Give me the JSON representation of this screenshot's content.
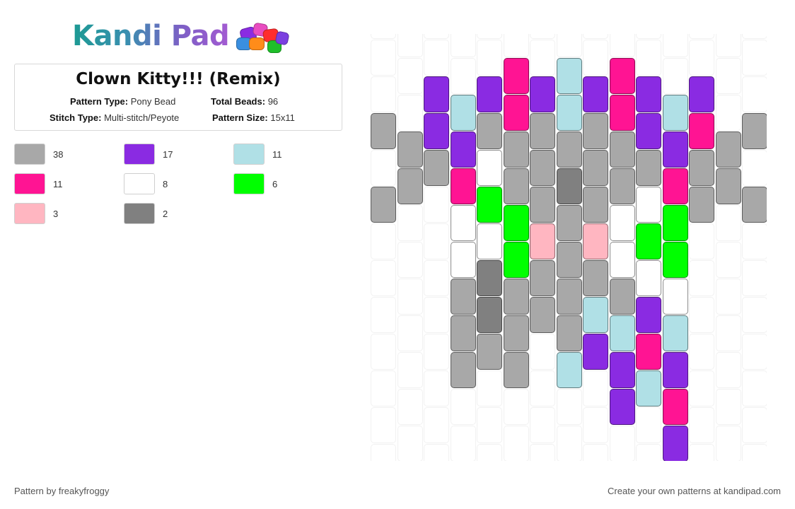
{
  "brand": {
    "name": "Kandi Pad"
  },
  "pattern": {
    "title": "Clown Kitty!!! (Remix)",
    "type_label": "Pattern Type:",
    "type_value": "Pony Bead",
    "total_label": "Total Beads:",
    "total_value": "96",
    "stitch_label": "Stitch Type:",
    "stitch_value": "Multi-stitch/Peyote",
    "size_label": "Pattern Size:",
    "size_value": "15x11"
  },
  "colors": {
    "gray": "#a8a8a8",
    "pink": "#ff1493",
    "lightpink": "#ffb6c1",
    "purple": "#8a2be2",
    "white": "#ffffff",
    "darkgray": "#808080",
    "lightblue": "#b0e0e6",
    "green": "#00ff00"
  },
  "legend": [
    {
      "color": "gray",
      "count": "38"
    },
    {
      "color": "purple",
      "count": "17"
    },
    {
      "color": "lightblue",
      "count": "11"
    },
    {
      "color": "pink",
      "count": "11"
    },
    {
      "color": "white",
      "count": "8"
    },
    {
      "color": "green",
      "count": "6"
    },
    {
      "color": "lightpink",
      "count": "3"
    },
    {
      "color": "darkgray",
      "count": "2"
    }
  ],
  "bead_columns": [
    [
      "-",
      "-",
      "-",
      "-",
      "-",
      "-",
      "g",
      "-",
      "g",
      "-",
      "-"
    ],
    [
      "-",
      "-",
      "-",
      "-",
      "-",
      "-",
      "-",
      "g",
      "g",
      "-",
      "-"
    ],
    [
      "-",
      "-",
      "-",
      "-",
      "-",
      "-",
      "-",
      "g",
      "P",
      "P",
      "-"
    ],
    [
      "-",
      "-",
      "g",
      "g",
      "g",
      "w",
      "w",
      "p",
      "P",
      "b",
      "-"
    ],
    [
      "-",
      "-",
      "g",
      "k",
      "k",
      "w",
      "G",
      "w",
      "g",
      "P",
      "-"
    ],
    [
      "-",
      "-",
      "g",
      "g",
      "g",
      "G",
      "G",
      "g",
      "g",
      "p",
      "p"
    ],
    [
      "-",
      "-",
      "-",
      "g",
      "g",
      "d",
      "g",
      "g",
      "g",
      "P",
      "-"
    ],
    [
      "-",
      "-",
      "b",
      "g",
      "g",
      "g",
      "g",
      "k",
      "g",
      "b",
      "b"
    ],
    [
      "-",
      "-",
      "P",
      "b",
      "g",
      "d",
      "g",
      "g",
      "g",
      "P",
      "-"
    ],
    [
      "-",
      "P",
      "P",
      "b",
      "g",
      "w",
      "w",
      "g",
      "g",
      "p",
      "p"
    ],
    [
      "-",
      "b",
      "p",
      "P",
      "w",
      "G",
      "w",
      "g",
      "P",
      "P",
      "-"
    ],
    [
      "P",
      "p",
      "P",
      "b",
      "w",
      "G",
      "G",
      "p",
      "P",
      "b",
      "-"
    ],
    [
      "-",
      "-",
      "-",
      "-",
      "-",
      "-",
      "g",
      "g",
      "p",
      "P",
      "-"
    ],
    [
      "-",
      "-",
      "-",
      "-",
      "-",
      "-",
      "-",
      "g",
      "g",
      "-",
      "-"
    ],
    [
      "-",
      "-",
      "-",
      "-",
      "-",
      "-",
      "g",
      "-",
      "g",
      "-",
      "-"
    ]
  ],
  "footer": {
    "credit": "Pattern by freakyfroggy",
    "cta": "Create your own patterns at kandipad.com"
  }
}
